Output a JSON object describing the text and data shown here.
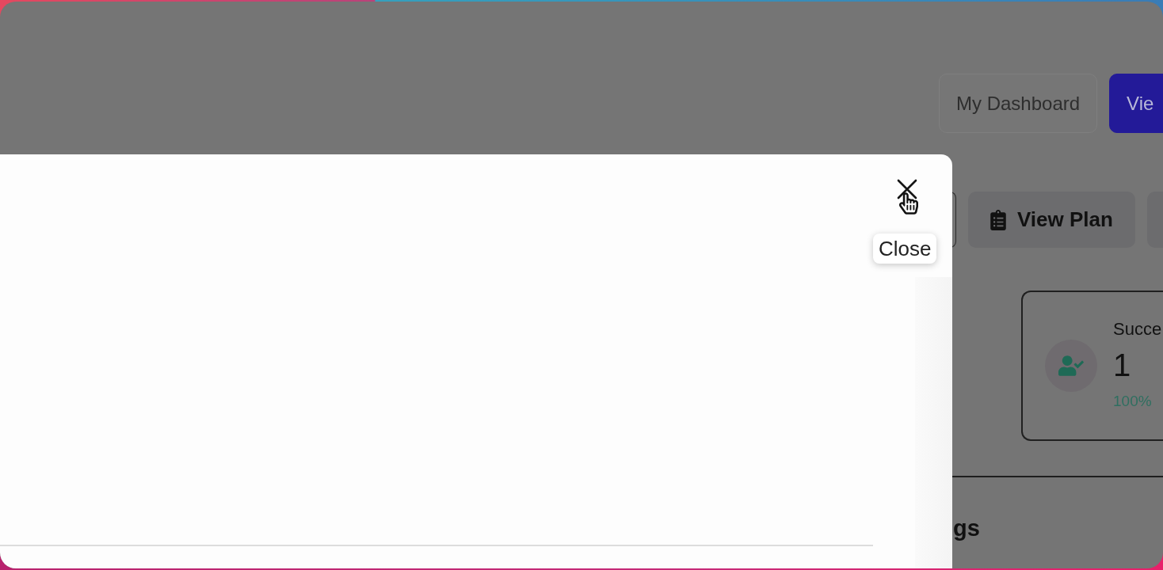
{
  "header_buttons": [
    {
      "label": "My Dashboard",
      "selected": false
    },
    {
      "label": "Vie",
      "selected": true
    }
  ],
  "actions": [
    {
      "kind": "outline"
    },
    {
      "kind": "filled",
      "label": "View Plan"
    },
    {
      "kind": "filled"
    }
  ],
  "stat_card": {
    "title": "Succe",
    "value": "1",
    "change": "100%"
  },
  "section": {
    "heading": "gs"
  },
  "modal": {
    "close_tooltip": "Close"
  }
}
